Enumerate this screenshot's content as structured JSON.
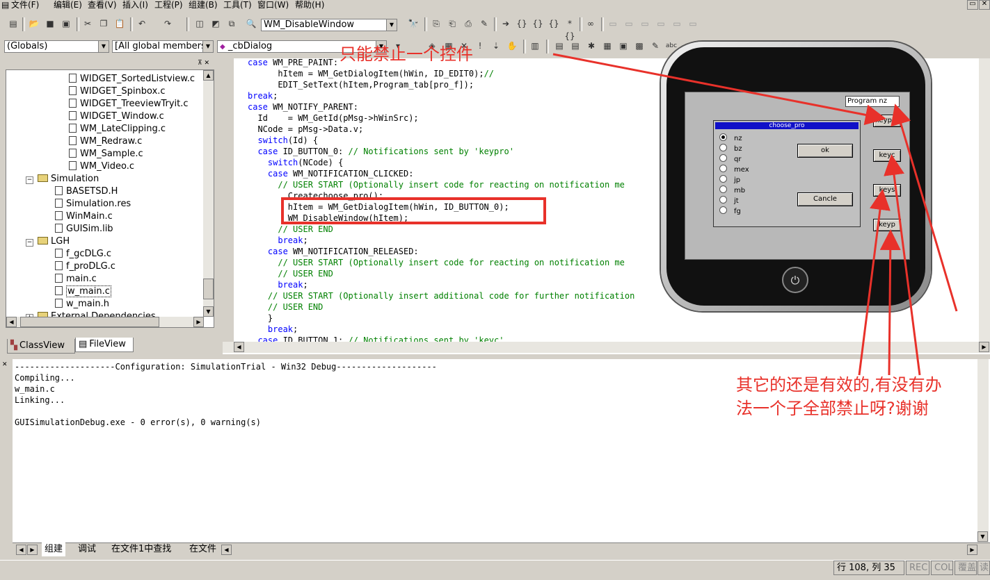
{
  "menu": [
    "文件(F)",
    "编辑(E)",
    "查看(V)",
    "插入(I)",
    "工程(P)",
    "组建(B)",
    "工具(T)",
    "窗口(W)",
    "帮助(H)"
  ],
  "toolbar": {
    "find_combo_value": "WM_DisableWindow",
    "scope_combo": "(Globals)",
    "members_combo": "[All global members",
    "function_combo": "_cbDialog"
  },
  "tree": {
    "items": [
      {
        "label": "WIDGET_SortedListview.c",
        "type": "file"
      },
      {
        "label": "WIDGET_Spinbox.c",
        "type": "file"
      },
      {
        "label": "WIDGET_TreeviewTryit.c",
        "type": "file"
      },
      {
        "label": "WIDGET_Window.c",
        "type": "file"
      },
      {
        "label": "WM_LateClipping.c",
        "type": "file"
      },
      {
        "label": "WM_Redraw.c",
        "type": "file"
      },
      {
        "label": "WM_Sample.c",
        "type": "file"
      },
      {
        "label": "WM_Video.c",
        "type": "file"
      },
      {
        "label": "Simulation",
        "type": "folder"
      },
      {
        "label": "BASETSD.H",
        "type": "file"
      },
      {
        "label": "Simulation.res",
        "type": "file"
      },
      {
        "label": "WinMain.c",
        "type": "file"
      },
      {
        "label": "GUISim.lib",
        "type": "file"
      },
      {
        "label": "LGH",
        "type": "folder"
      },
      {
        "label": "f_gcDLG.c",
        "type": "file"
      },
      {
        "label": "f_proDLG.c",
        "type": "file"
      },
      {
        "label": "main.c",
        "type": "file"
      },
      {
        "label": "w_main.c",
        "type": "file"
      },
      {
        "label": "w_main.h",
        "type": "file"
      },
      {
        "label": "External Dependencies",
        "type": "folder"
      }
    ],
    "tab_classview": "ClassView",
    "tab_fileview": "FileView"
  },
  "code_lines": [
    "case WM_PRE_PAINT:",
    "      hItem = WM_GetDialogItem(hWin, ID_EDIT0);//",
    "      EDIT_SetText(hItem,Program_tab[pro_f]);",
    "break;",
    "case WM_NOTIFY_PARENT:",
    "  Id    = WM_GetId(pMsg->hWinSrc);",
    "  NCode = pMsg->Data.v;",
    "  switch(Id) {",
    "  case ID_BUTTON_0: // Notifications sent by 'keypro'",
    "    switch(NCode) {",
    "    case WM_NOTIFICATION_CLICKED:",
    "      // USER START (Optionally insert code for reacting on notification me",
    "        Createchoose_pro();",
    "        hItem = WM_GetDialogItem(hWin, ID_BUTTON_0);",
    "        WM_DisableWindow(hItem);",
    "      // USER END",
    "      break;",
    "    case WM_NOTIFICATION_RELEASED:",
    "      // USER START (Optionally insert code for reacting on notification me",
    "      // USER END",
    "      break;",
    "    // USER START (Optionally insert additional code for further notification",
    "    // USER END",
    "    }",
    "    break;",
    "  case ID_BUTTON_1: // Notifications sent by 'keyc'"
  ],
  "output_lines": [
    "--------------------Configuration: SimulationTrial - Win32 Debug--------------------",
    "Compiling...",
    "w_main.c",
    "Linking...",
    "",
    "GUISimulationDebug.exe - 0 error(s), 0 warning(s)"
  ],
  "output_tabs": [
    "组建",
    "调试",
    "在文件1中查找",
    "在文件"
  ],
  "device": {
    "edit_value": "Program nz",
    "buttons": [
      "keypro",
      "keyc",
      "keys",
      "keyp"
    ],
    "dialog_title": "choose_pro",
    "radios": [
      "nz",
      "bz",
      "qr",
      "mex",
      "jp",
      "mb",
      "jt",
      "fg"
    ],
    "ok_label": "ok",
    "cancel_label": "Cancle"
  },
  "annotations": {
    "top": "只能禁止一个控件",
    "bottom_line1": "其它的还是有效的,有没有办",
    "bottom_line2": "法一个子全部禁止呀?谢谢"
  },
  "status": {
    "position": "行 108, 列 35",
    "rec": "REC",
    "col": "COL",
    "ovr": "覆盖",
    "read": "读"
  },
  "colors": {
    "annotation": "#e8312a",
    "keyword": "#0000ff",
    "comment": "#008000"
  }
}
